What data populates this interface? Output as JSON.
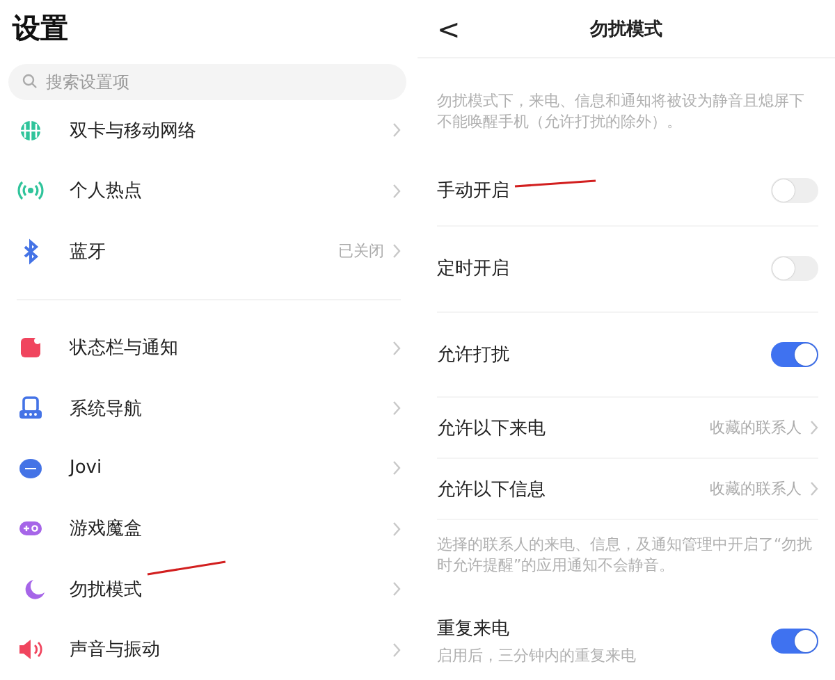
{
  "settings": {
    "title": "设置",
    "search": {
      "placeholder": "搜索设置项"
    },
    "groups": [
      [
        {
          "label": "双卡与移动网络"
        },
        {
          "label": "个人热点"
        },
        {
          "label": "蓝牙",
          "value": "已关闭"
        }
      ],
      [
        {
          "label": "状态栏与通知"
        },
        {
          "label": "系统导航"
        },
        {
          "label": "Jovi"
        },
        {
          "label": "游戏魔盒"
        },
        {
          "label": "勿扰模式"
        },
        {
          "label": "声音与振动"
        }
      ]
    ]
  },
  "dnd": {
    "title": "勿扰模式",
    "back": "<",
    "description": "勿扰模式下，来电、信息和通知将被设为静音且熄屏下不能唤醒手机（允许打扰的除外）。",
    "rows": [
      {
        "kind": "toggle",
        "label": "手动开启",
        "on": false
      },
      {
        "kind": "toggle",
        "label": "定时开启",
        "on": false
      },
      {
        "kind": "toggle",
        "label": "允许打扰",
        "on": true
      },
      {
        "kind": "link",
        "label": "允许以下来电",
        "value": "收藏的联系人"
      },
      {
        "kind": "link",
        "label": "允许以下信息",
        "value": "收藏的联系人"
      },
      {
        "kind": "note",
        "label": "选择的联系人的来电、信息，及通知管理中开启了“勿扰时允许提醒”的应用通知不会静音。"
      },
      {
        "kind": "toggle",
        "label": "重复来电",
        "sub": "启用后，三分钟内的重复来电",
        "on": true
      }
    ]
  }
}
